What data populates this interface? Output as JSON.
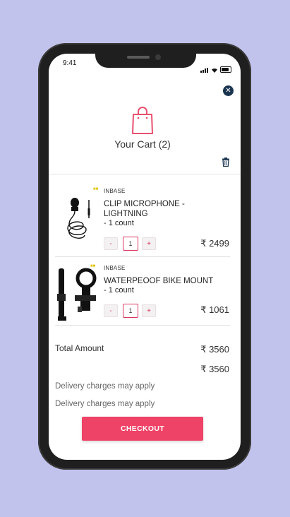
{
  "status_bar": {
    "time": "9:41"
  },
  "header": {
    "title": "Your Cart (2)"
  },
  "items": [
    {
      "brand": "INBASE",
      "name": "CLIP MICROPHONE - LIGHTNING",
      "count": "- 1 count",
      "qty": "1",
      "minus": "-",
      "plus": "+",
      "price": "₹ 2499"
    },
    {
      "brand": "INBASE",
      "name": "WATERPEOOF BIKE MOUNT",
      "count": "- 1 count",
      "qty": "1",
      "minus": "-",
      "plus": "+",
      "price": "₹ 1061"
    }
  ],
  "summary": {
    "total_label": "Total Amount",
    "total_amount": "₹ 3560",
    "grand_total": "₹ 3560",
    "delivery_note_1": "Delivery charges may apply",
    "delivery_note_2": "Delivery charges may apply"
  },
  "checkout": {
    "label": "CHECKOUT"
  },
  "colors": {
    "accent": "#ee4266",
    "background": "#c2c3ec",
    "close_button": "#1a3450"
  }
}
